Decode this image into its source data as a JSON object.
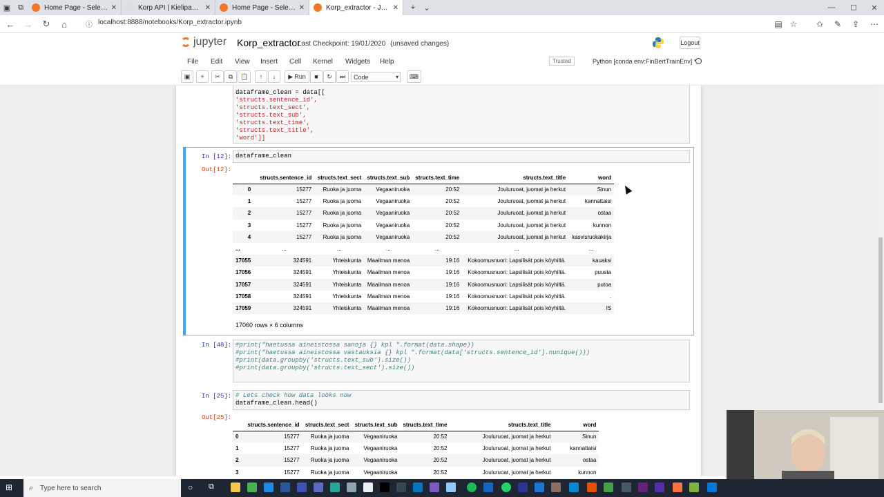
{
  "browser": {
    "tabs": [
      {
        "label": "Home Page - Select or creat",
        "color": "#f37726"
      },
      {
        "label": "Korp API | Kielipankki",
        "color": "#8bc34a"
      },
      {
        "label": "Home Page - Select or creat",
        "color": "#f37726"
      },
      {
        "label": "Korp_extractor - Jupyter",
        "color": "#f37726"
      }
    ],
    "url": "localhost:8888/notebooks/Korp_extractor.ipynb"
  },
  "jupyter": {
    "logo_text": "jupyter",
    "notebook_name": "Korp_extractor",
    "checkpoint": "Last Checkpoint: 19/01/2020",
    "unsaved": "(unsaved changes)",
    "logout_label": "Logout",
    "menu": [
      "File",
      "Edit",
      "View",
      "Insert",
      "Cell",
      "Kernel",
      "Widgets",
      "Help"
    ],
    "trusted_label": "Trusted",
    "kernel_label": "Python [conda env:FinBertTrainEnv] *",
    "run_label": "Run",
    "cell_type": "Code"
  },
  "cells": {
    "cell0": {
      "lines": [
        "dataframe_clean = data[[",
        "'structs.sentence_id',",
        "'structs.text_sect',",
        "'structs.text_sub',",
        "'structs.text_time',",
        "'structs.text_title',",
        "'word']]"
      ]
    },
    "cell1": {
      "in_prompt": "In [12]:",
      "code": "dataframe_clean",
      "out_prompt": "Out[12]:",
      "shape": "17060 rows × 6 columns"
    },
    "cell2": {
      "in_prompt": "In [48]:",
      "lines": [
        "#print(\"haetussa aineistossa sanoja {} kpl \".format(data.shape))",
        "#print(\"haetussa aineistossa vastauksia {} kpl \".format(data['structs.sentence_id'].nunique()))",
        "#print(data.groupby('structs.text_sub').size())",
        "#print(data.groupby('structs.text_sect').size())"
      ]
    },
    "cell3": {
      "in_prompt": "In [25]:",
      "lines": [
        "# Lets check how data looks now",
        "dataframe_clean.head()"
      ],
      "out_prompt": "Out[25]:"
    }
  },
  "table1": {
    "headers": [
      "",
      "structs.sentence_id",
      "structs.text_sect",
      "structs.text_sub",
      "structs.text_time",
      "structs.text_title",
      "word"
    ],
    "rows": [
      [
        "0",
        "15277",
        "Ruoka ja juoma",
        "Vegaaniruoka",
        "20:52",
        "Jouluruoat, juomat ja herkut",
        "Sinun"
      ],
      [
        "1",
        "15277",
        "Ruoka ja juoma",
        "Vegaaniruoka",
        "20:52",
        "Jouluruoat, juomat ja herkut",
        "kannattaisi"
      ],
      [
        "2",
        "15277",
        "Ruoka ja juoma",
        "Vegaaniruoka",
        "20:52",
        "Jouluruoat, juomat ja herkut",
        "ostaa"
      ],
      [
        "3",
        "15277",
        "Ruoka ja juoma",
        "Vegaaniruoka",
        "20:52",
        "Jouluruoat, juomat ja herkut",
        "kunnon"
      ],
      [
        "4",
        "15277",
        "Ruoka ja juoma",
        "Vegaaniruoka",
        "20:52",
        "Jouluruoat, juomat ja herkut",
        "kasvisruokakirja"
      ],
      [
        "...",
        "...",
        "...",
        "...",
        "...",
        "...",
        "..."
      ],
      [
        "17055",
        "324591",
        "Yhteiskunta",
        "Maailman menoa",
        "19:16",
        "Kokoomusnuori: Lapsilisät pois köyhiltä.",
        "kauaksi"
      ],
      [
        "17056",
        "324591",
        "Yhteiskunta",
        "Maailman menoa",
        "19:16",
        "Kokoomusnuori: Lapsilisät pois köyhiltä.",
        "puusta"
      ],
      [
        "17057",
        "324591",
        "Yhteiskunta",
        "Maailman menoa",
        "19:16",
        "Kokoomusnuori: Lapsilisät pois köyhiltä.",
        "putoa"
      ],
      [
        "17058",
        "324591",
        "Yhteiskunta",
        "Maailman menoa",
        "19:16",
        "Kokoomusnuori: Lapsilisät pois köyhiltä.",
        "."
      ],
      [
        "17059",
        "324591",
        "Yhteiskunta",
        "Maailman menoa",
        "19:16",
        "Kokoomusnuori: Lapsilisät pois köyhiltä.",
        "IS"
      ]
    ]
  },
  "table2": {
    "headers": [
      "",
      "structs.sentence_id",
      "structs.text_sect",
      "structs.text_sub",
      "structs.text_time",
      "structs.text_title",
      "word"
    ],
    "rows": [
      [
        "0",
        "15277",
        "Ruoka ja juoma",
        "Vegaaniruoka",
        "20:52",
        "Jouluruoat, juomat ja herkut",
        "Sinun"
      ],
      [
        "1",
        "15277",
        "Ruoka ja juoma",
        "Vegaaniruoka",
        "20:52",
        "Jouluruoat, juomat ja herkut",
        "kannattaisi"
      ],
      [
        "2",
        "15277",
        "Ruoka ja juoma",
        "Vegaaniruoka",
        "20:52",
        "Jouluruoat, juomat ja herkut",
        "ostaa"
      ],
      [
        "3",
        "15277",
        "Ruoka ja juoma",
        "Vegaaniruoka",
        "20:52",
        "Jouluruoat, juomat ja herkut",
        "kunnon"
      ]
    ]
  },
  "taskbar": {
    "search_placeholder": "Type here to search"
  }
}
